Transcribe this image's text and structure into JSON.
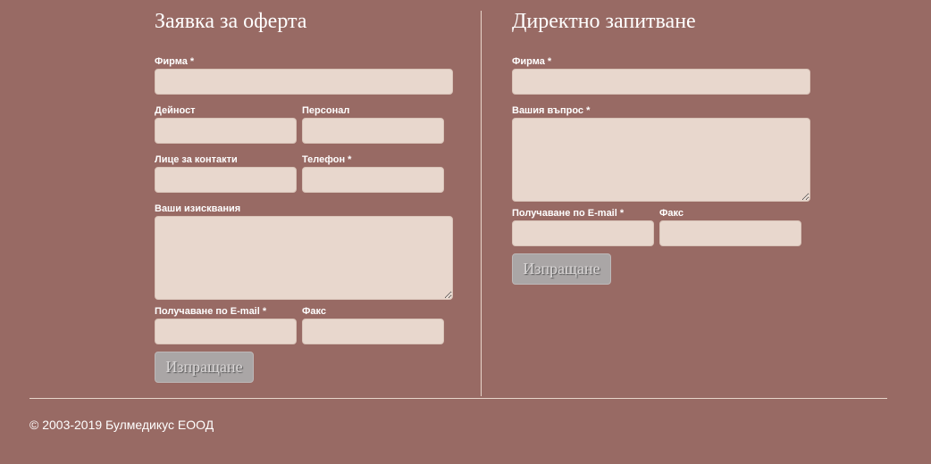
{
  "offer_form": {
    "title": "Заявка за оферта",
    "company_label": "Фирма *",
    "activity_label": "Дейност",
    "staff_label": "Персонал",
    "contact_person_label": "Лице за контакти",
    "phone_label": "Телефон *",
    "requirements_label": "Ваши изисквания",
    "email_label": "Получаване по E-mail *",
    "fax_label": "Факс",
    "submit_label": "Изпращане"
  },
  "inquiry_form": {
    "title": "Директно запитване",
    "company_label": "Фирма *",
    "question_label": "Вашия въпрос *",
    "email_label": "Получаване по E-mail *",
    "fax_label": "Факс",
    "submit_label": "Изпращане"
  },
  "footer": {
    "copyright": "© 2003-2019 Булмедикус ЕООД"
  },
  "colors": {
    "background": "#986a64",
    "field": "#e8d7cd",
    "button": "#aaa6a6"
  }
}
